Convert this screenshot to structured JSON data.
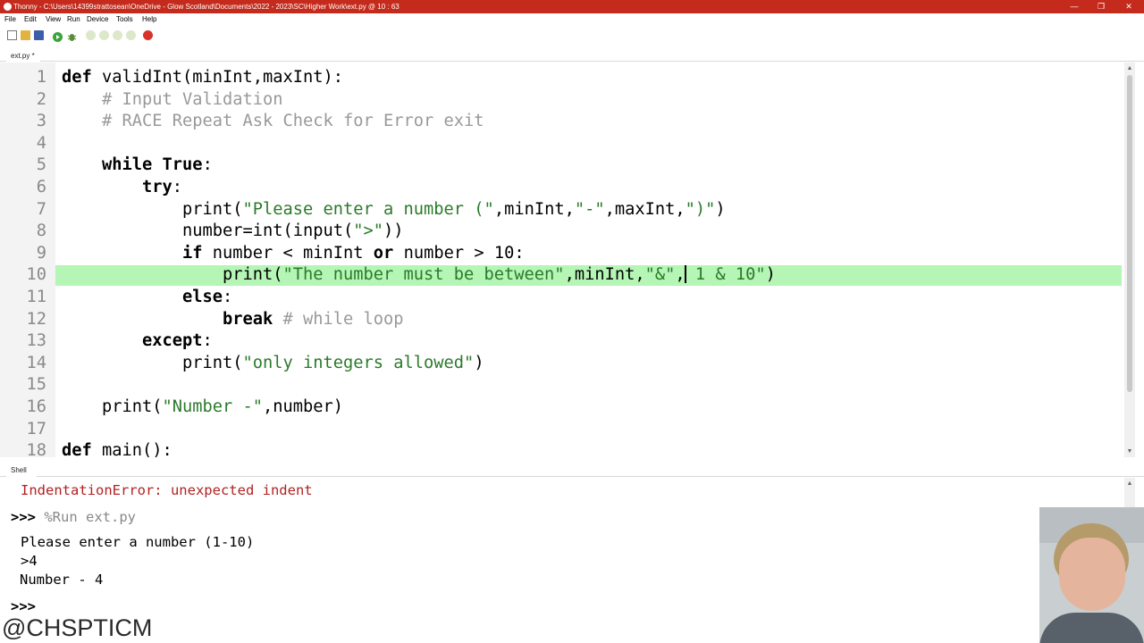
{
  "window": {
    "title": "Thonny  -  C:\\Users\\14399strattosean\\OneDrive - Glow Scotland\\Documents\\2022 - 2023\\SC\\Higher Work\\ext.py  @  10 : 63",
    "accent_color": "#c42b1c",
    "minimize_glyph": "—",
    "restore_glyph": "❐",
    "close_glyph": "✕"
  },
  "menu": [
    "File",
    "Edit",
    "View",
    "Run",
    "Device",
    "Tools",
    "Help"
  ],
  "toolbar": {
    "icons": [
      "new-file-icon",
      "open-file-icon",
      "save-icon",
      "run-icon",
      "debug-icon",
      "step-over-icon",
      "step-into-icon",
      "step-out-icon",
      "resume-icon",
      "stop-icon"
    ]
  },
  "editor": {
    "tab_label": "ext.py *",
    "cursor_line": 10,
    "lines": [
      {
        "n": "1"
      },
      {
        "n": "2"
      },
      {
        "n": "3"
      },
      {
        "n": "4"
      },
      {
        "n": "5"
      },
      {
        "n": "6"
      },
      {
        "n": "7"
      },
      {
        "n": "8"
      },
      {
        "n": "9"
      },
      {
        "n": "10"
      },
      {
        "n": "11"
      },
      {
        "n": "12"
      },
      {
        "n": "13"
      },
      {
        "n": "14"
      },
      {
        "n": "15"
      },
      {
        "n": "16"
      },
      {
        "n": "17"
      },
      {
        "n": "18"
      }
    ],
    "tokens": {
      "l1_def": "def",
      "l1_rest": " validInt(minInt,maxInt):",
      "l2": "    # Input Validation",
      "l3": "    # RACE Repeat Ask Check for Error exit",
      "l5_kw1": "while",
      "l5_kw2": "True",
      "l5_colon": ":",
      "l6_kw": "try",
      "l6_colon": ":",
      "l7_a": "print(",
      "l7_s1": "\"Please enter a number (\"",
      "l7_b": ",minInt,",
      "l7_s2": "\"-\"",
      "l7_c": ",maxInt,",
      "l7_s3": "\")\"",
      "l7_d": ")",
      "l8_a": "number=int(input(",
      "l8_s": "\">\"",
      "l8_b": "))",
      "l9_kw1": "if",
      "l9_a": " number < minInt ",
      "l9_kw2": "or",
      "l9_b": " number > 10:",
      "l10_a": "print(",
      "l10_s1": "\"The number must be between\"",
      "l10_b": ",minInt,",
      "l10_s2": "\"&\"",
      "l10_c": ",",
      "l10_s3": " 1 & 10\"",
      "l10_d": ")",
      "l11_kw": "else",
      "l11_colon": ":",
      "l12_kw": "break",
      "l12_cmt": " # while loop",
      "l13_kw": "except",
      "l13_colon": ":",
      "l14_a": "print(",
      "l14_s": "\"only integers allowed\"",
      "l14_b": ")",
      "l16_a": "print(",
      "l16_s": "\"Number -\"",
      "l16_b": ",number)",
      "l18_kw": "def",
      "l18_rest": " main():"
    }
  },
  "shell": {
    "tab_label": "Shell",
    "error": "IndentationError: unexpected indent",
    "prompt": ">>> ",
    "run_command": "%Run ext.py",
    "out1": "Please enter a number (1-10)",
    "out2": ">4",
    "out3": "Number - 4",
    "final_prompt": ">>>"
  },
  "overlay": {
    "handle": "@CHSPTICM"
  }
}
